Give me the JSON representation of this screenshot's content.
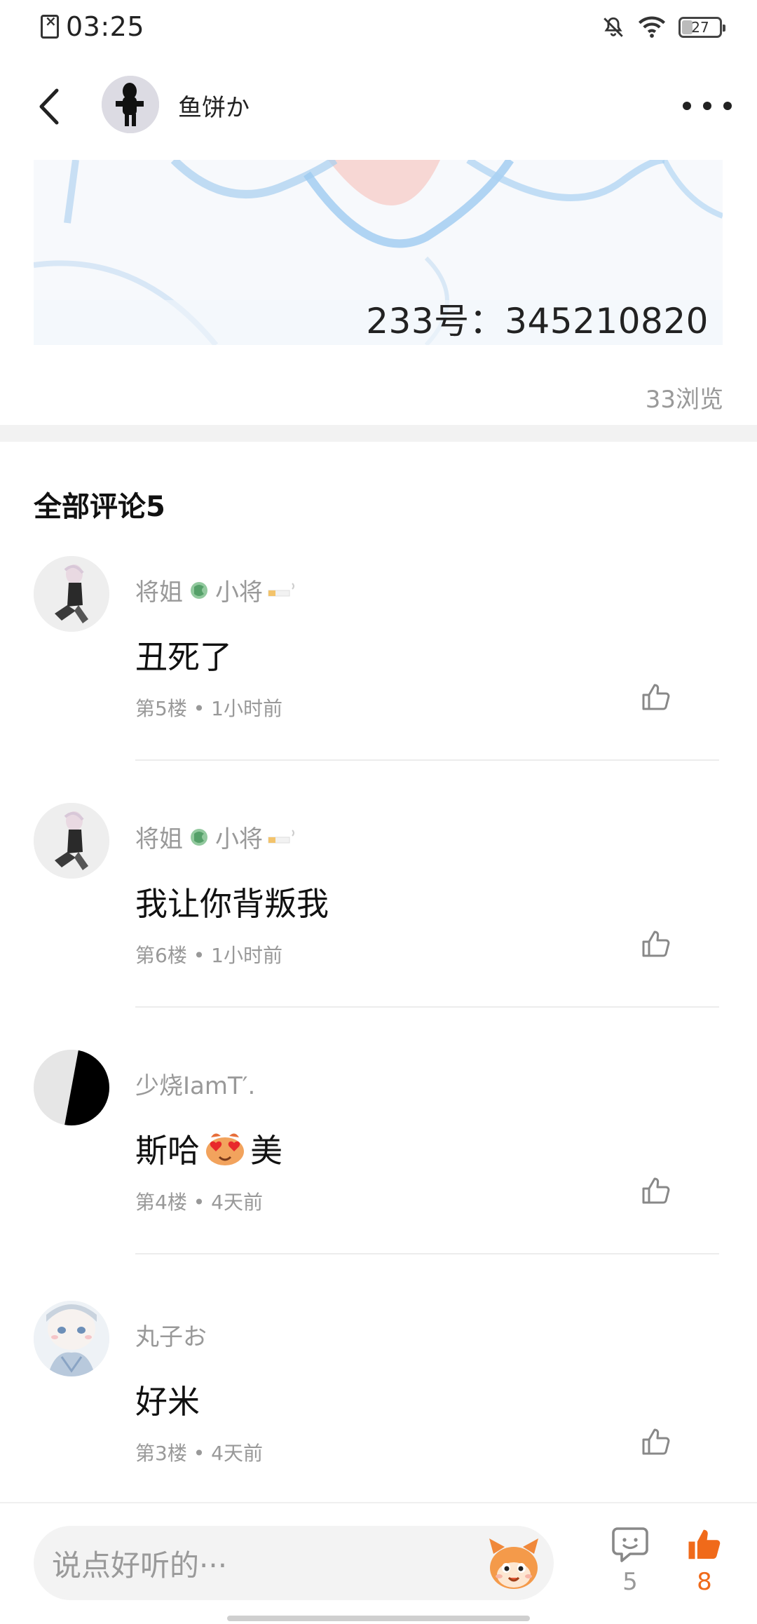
{
  "status_bar": {
    "time": "03:25",
    "battery": "27"
  },
  "header": {
    "author_name": "鱼饼か"
  },
  "post": {
    "image_text": "233号：345210820",
    "views": "33浏览"
  },
  "comments_section": {
    "title": "全部评论5"
  },
  "comments": [
    {
      "user": "将姐",
      "user_suffix": "小将",
      "text": "丑死了",
      "meta": "第5楼 • 1小时前"
    },
    {
      "user": "将姐",
      "user_suffix": "小将",
      "text": "我让你背叛我",
      "meta": "第6楼 • 1小时前"
    },
    {
      "user": "少烧IamT′.",
      "text": "斯哈",
      "text_suffix": "美",
      "meta": "第4楼 • 4天前"
    },
    {
      "user": "丸子お",
      "text": "好米",
      "meta": "第3楼 • 4天前"
    }
  ],
  "bottom_bar": {
    "input_placeholder": "说点好听的···",
    "comment_count": "5",
    "like_count": "8"
  },
  "colors": {
    "accent": "#f06a1a",
    "muted_text": "#999999"
  }
}
